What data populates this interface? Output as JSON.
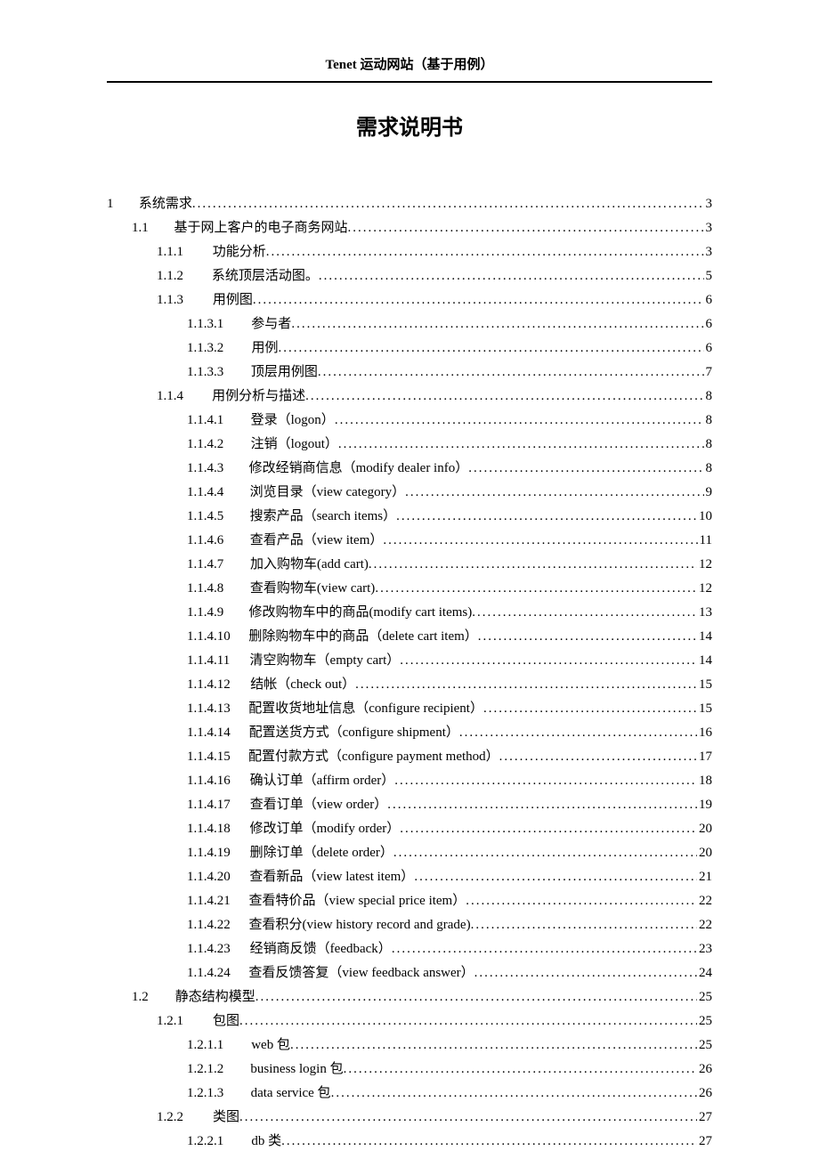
{
  "header": "Tenet 运动网站（基于用例）",
  "title": "需求说明书",
  "toc": [
    {
      "indent": 0,
      "num": "1",
      "label": "系统需求",
      "page": "3"
    },
    {
      "indent": 1,
      "num": "1.1",
      "label": "基于网上客户的电子商务网站",
      "page": "3"
    },
    {
      "indent": 2,
      "num": "1.1.1",
      "label": "功能分析",
      "page": "3"
    },
    {
      "indent": 2,
      "num": "1.1.2",
      "label": "系统顶层活动图。",
      "page": "5"
    },
    {
      "indent": 2,
      "num": "1.1.3",
      "label": "用例图",
      "page": "6"
    },
    {
      "indent": 3,
      "num": "1.1.3.1",
      "label": "参与者",
      "page": "6"
    },
    {
      "indent": 3,
      "num": "1.1.3.2",
      "label": "用例",
      "page": "6"
    },
    {
      "indent": 3,
      "num": "1.1.3.3",
      "label": "顶层用例图",
      "page": "7"
    },
    {
      "indent": 2,
      "num": "1.1.4",
      "label": "用例分析与描述",
      "page": "8"
    },
    {
      "indent": 3,
      "num": "1.1.4.1",
      "label": "登录（logon）",
      "page": "8"
    },
    {
      "indent": 3,
      "num": "1.1.4.2",
      "label": "注销（logout）",
      "page": "8"
    },
    {
      "indent": 3,
      "num": "1.1.4.3",
      "label": "修改经销商信息（modify dealer info）",
      "page": "8"
    },
    {
      "indent": 3,
      "num": "1.1.4.4",
      "label": "浏览目录（view category）",
      "page": "9"
    },
    {
      "indent": 3,
      "num": "1.1.4.5",
      "label": "搜索产品（search items）",
      "page": "10"
    },
    {
      "indent": 3,
      "num": "1.1.4.6",
      "label": "查看产品（view item）",
      "page": "11"
    },
    {
      "indent": 3,
      "num": "1.1.4.7",
      "label": "加入购物车(add cart)",
      "page": "12"
    },
    {
      "indent": 3,
      "num": "1.1.4.8",
      "label": "查看购物车(view cart)",
      "page": "12"
    },
    {
      "indent": 3,
      "num": "1.1.4.9",
      "label": "修改购物车中的商品(modify cart items)",
      "page": "13"
    },
    {
      "indent": 3,
      "num": "1.1.4.10",
      "label": "删除购物车中的商品（delete cart item）",
      "page": "14"
    },
    {
      "indent": 3,
      "num": "1.1.4.11",
      "label": "清空购物车（empty cart）",
      "page": "14"
    },
    {
      "indent": 3,
      "num": "1.1.4.12",
      "label": "结帐（check out）",
      "page": "15"
    },
    {
      "indent": 3,
      "num": "1.1.4.13",
      "label": "配置收货地址信息（configure recipient）",
      "page": "15"
    },
    {
      "indent": 3,
      "num": "1.1.4.14",
      "label": "配置送货方式（configure shipment）",
      "page": "16"
    },
    {
      "indent": 3,
      "num": "1.1.4.15",
      "label": "配置付款方式（configure payment method）",
      "page": "17"
    },
    {
      "indent": 3,
      "num": "1.1.4.16",
      "label": "确认订单（affirm order）",
      "page": "18"
    },
    {
      "indent": 3,
      "num": "1.1.4.17",
      "label": "查看订单（view order）",
      "page": "19"
    },
    {
      "indent": 3,
      "num": "1.1.4.18",
      "label": "修改订单（modify order）",
      "page": "20"
    },
    {
      "indent": 3,
      "num": "1.1.4.19",
      "label": "删除订单（delete order）",
      "page": "20"
    },
    {
      "indent": 3,
      "num": "1.1.4.20",
      "label": "查看新品（view latest item）",
      "page": "21"
    },
    {
      "indent": 3,
      "num": "1.1.4.21",
      "label": "查看特价品（view special price item）",
      "page": "22"
    },
    {
      "indent": 3,
      "num": "1.1.4.22",
      "label": "查看积分(view history record and grade)",
      "page": "22"
    },
    {
      "indent": 3,
      "num": "1.1.4.23",
      "label": "经销商反馈（feedback）",
      "page": "23"
    },
    {
      "indent": 3,
      "num": "1.1.4.24",
      "label": "查看反馈答复（view feedback answer）",
      "page": "24"
    },
    {
      "indent": 1,
      "num": "1.2",
      "label": "静态结构模型",
      "page": "25"
    },
    {
      "indent": 2,
      "num": "1.2.1",
      "label": "包图",
      "page": "25"
    },
    {
      "indent": 3,
      "num": "1.2.1.1",
      "label": "web 包",
      "page": "25"
    },
    {
      "indent": 3,
      "num": "1.2.1.2",
      "label": "business login 包",
      "page": "26"
    },
    {
      "indent": 3,
      "num": "1.2.1.3",
      "label": "data service 包",
      "page": "26"
    },
    {
      "indent": 2,
      "num": "1.2.2",
      "label": "类图",
      "page": "27"
    },
    {
      "indent": 3,
      "num": "1.2.2.1",
      "label": "db 类",
      "page": "27"
    }
  ]
}
